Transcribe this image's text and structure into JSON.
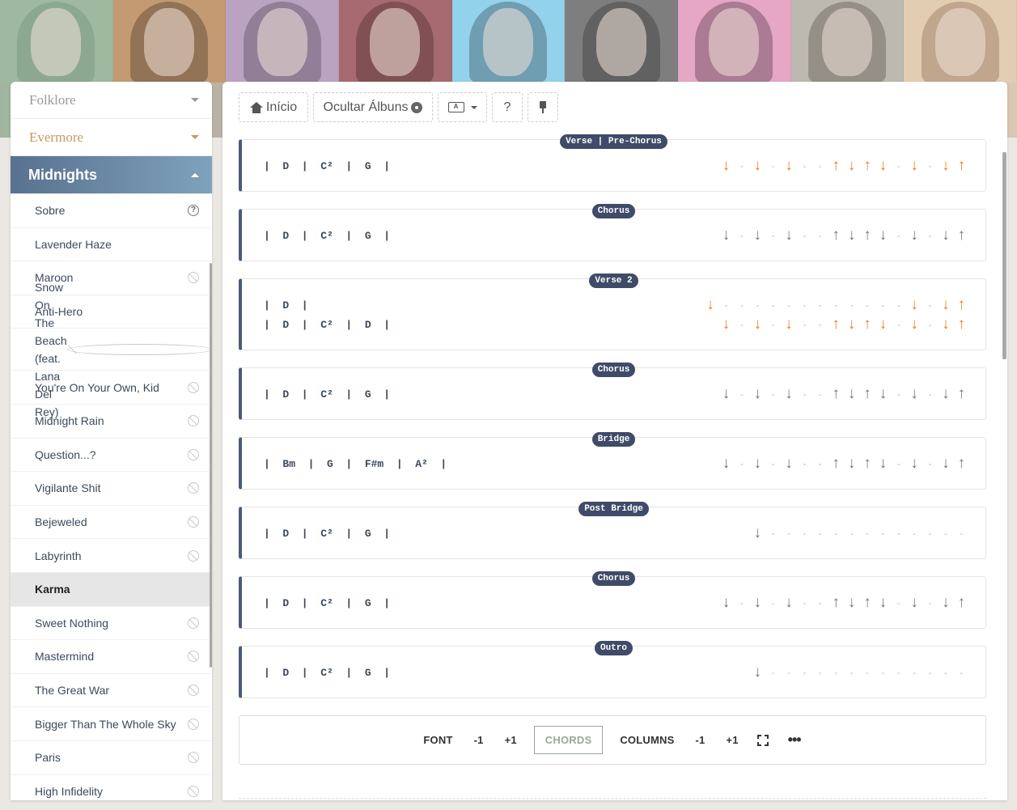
{
  "banner": {
    "tiles": [
      {
        "bg": "#9fb8a0",
        "fg": "#6d8a72"
      },
      {
        "bg": "#c49a72",
        "fg": "#3a2a1f"
      },
      {
        "bg": "#b9a3c0",
        "fg": "#4a3a4a"
      },
      {
        "bg": "#a76a70",
        "fg": "#3b1f23"
      },
      {
        "bg": "#92d2ea",
        "fg": "#2d3b48"
      },
      {
        "bg": "#7e7e7e",
        "fg": "#2a2a2a"
      },
      {
        "bg": "#e6a6c6",
        "fg": "#3a2a35"
      },
      {
        "bg": "#bdb9b1",
        "fg": "#4a4238"
      },
      {
        "bg": "#e3cdb2",
        "fg": "#7a5e44"
      }
    ]
  },
  "sidebar": {
    "albums": {
      "folklore": "Folklore",
      "evermore": "Evermore",
      "active": "Midnights"
    },
    "songs": [
      {
        "title": "Sobre",
        "icon": "help-icon"
      },
      {
        "title": "Lavender Haze",
        "icon": ""
      },
      {
        "title": "Maroon",
        "icon": "ban-icon"
      },
      {
        "title": "Anti-Hero",
        "icon": ""
      },
      {
        "title": "Snow On The Beach (feat. Lana Del Rey)",
        "icon": "ban-icon"
      },
      {
        "title": "You're On Your Own, Kid",
        "icon": "ban-icon"
      },
      {
        "title": "Midnight Rain",
        "icon": "ban-icon"
      },
      {
        "title": "Question...?",
        "icon": "ban-icon"
      },
      {
        "title": "Vigilante Shit",
        "icon": "ban-icon"
      },
      {
        "title": "Bejeweled",
        "icon": "ban-icon"
      },
      {
        "title": "Labyrinth",
        "icon": "ban-icon"
      },
      {
        "title": "Karma",
        "icon": "",
        "selected": true
      },
      {
        "title": "Sweet Nothing",
        "icon": "ban-icon"
      },
      {
        "title": "Mastermind",
        "icon": "ban-icon"
      },
      {
        "title": "The Great War",
        "icon": "ban-icon"
      },
      {
        "title": "Bigger Than The Whole Sky",
        "icon": "ban-icon"
      },
      {
        "title": "Paris",
        "icon": "ban-icon"
      },
      {
        "title": "High Infidelity",
        "icon": "ban-icon"
      }
    ]
  },
  "toolbar": {
    "home": "Início",
    "hide_albums": "Ocultar Álbuns",
    "help": "?"
  },
  "sections": [
    {
      "label": "Verse | Pre-Chorus",
      "color": "orange",
      "rows": [
        {
          "chords": "|  D  |  C²  |  G  |",
          "strum": "↓-↓-↓--↑↓↑↓-↓-↓↑"
        }
      ]
    },
    {
      "label": "Chorus",
      "color": "gray",
      "rows": [
        {
          "chords": "|  D  |  C²  |  G  |",
          "strum": "↓-↓-↓--↑↓↑↓-↓-↓↑"
        }
      ]
    },
    {
      "label": "Verse 2",
      "color": "orange",
      "rows": [
        {
          "chords": "|  D  |",
          "strum": "↓------------↓-↓↑"
        },
        {
          "chords": "|  D  |  C²  |  D  |",
          "strum": "↓-↓-↓--↑↓↑↓-↓-↓↑"
        }
      ]
    },
    {
      "label": "Chorus",
      "color": "gray",
      "rows": [
        {
          "chords": "|  D  |  C²  |  G  |",
          "strum": "↓-↓-↓--↑↓↑↓-↓-↓↑"
        }
      ]
    },
    {
      "label": "Bridge",
      "color": "gray",
      "rows": [
        {
          "chords": "|  Bm  |  G  |  F#m  |  A²  |",
          "strum": "↓-↓-↓--↑↓↑↓-↓-↓↑"
        }
      ]
    },
    {
      "label": "Post Bridge",
      "color": "gray",
      "rows": [
        {
          "chords": "|  D  |  C²  |  G  |",
          "strum": "↓-------------"
        }
      ]
    },
    {
      "label": "Chorus",
      "color": "gray",
      "rows": [
        {
          "chords": "|  D  |  C²  |  G  |",
          "strum": "↓-↓-↓--↑↓↑↓-↓-↓↑"
        }
      ]
    },
    {
      "label": "Outro",
      "color": "gray",
      "rows": [
        {
          "chords": "|  D  |  C²  |  G  |",
          "strum": "↓-------------"
        }
      ]
    }
  ],
  "bottombar": {
    "font": "FONT",
    "font_minus": "-1",
    "font_plus": "+1",
    "chords": "CHORDS",
    "columns": "COLUMNS",
    "col_minus": "-1",
    "col_plus": "+1"
  }
}
